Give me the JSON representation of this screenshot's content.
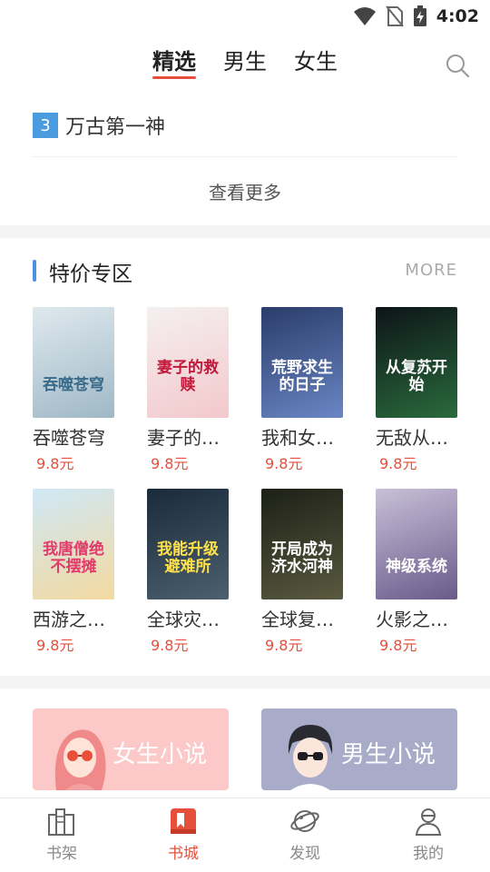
{
  "status_bar": {
    "time": "4:02",
    "icons": [
      "wifi-icon",
      "no-sim-icon",
      "battery-charging-icon"
    ]
  },
  "top_tabs": {
    "tabs": [
      "精选",
      "男生",
      "女生"
    ],
    "active_index": 0,
    "search_icon": "search-icon"
  },
  "rank": {
    "number": "3",
    "title": "万古第一神"
  },
  "more_link": "查看更多",
  "special_section": {
    "title": "特价专区",
    "more": "MORE",
    "books": [
      {
        "title": "吞噬苍穹",
        "price": "9.8元",
        "cover_text": "吞噬苍穹",
        "cover_colors": [
          "#dfe9ee",
          "#9fb8c6"
        ],
        "cover_text_color": "#3a6b8a"
      },
      {
        "title": "妻子的…",
        "price": "9.8元",
        "cover_text": "妻子的救赎",
        "cover_colors": [
          "#f4f0f0",
          "#f3c8cc"
        ],
        "cover_text_color": "#c2183a"
      },
      {
        "title": "我和女…",
        "price": "9.8元",
        "cover_text": "荒野求生的日子",
        "cover_colors": [
          "#2a3c6a",
          "#6a86c4"
        ],
        "cover_text_color": "#ffffff"
      },
      {
        "title": "无敌从…",
        "price": "9.8元",
        "cover_text": "从复苏开始",
        "cover_colors": [
          "#0d1418",
          "#2a6a3c"
        ],
        "cover_text_color": "#ffffff"
      },
      {
        "title": "西游之…",
        "price": "9.8元",
        "cover_text": "我唐僧绝不摆摊",
        "cover_colors": [
          "#cfe8f6",
          "#f3d9a0"
        ],
        "cover_text_color": "#e23a6a"
      },
      {
        "title": "全球灾…",
        "price": "9.8元",
        "cover_text": "我能升级避难所",
        "cover_colors": [
          "#1a2a3a",
          "#4c6070"
        ],
        "cover_text_color": "#ffe14a"
      },
      {
        "title": "全球复…",
        "price": "9.8元",
        "cover_text": "开局成为济水河神",
        "cover_colors": [
          "#1c2016",
          "#5a5a40"
        ],
        "cover_text_color": "#ffffff"
      },
      {
        "title": "火影之…",
        "price": "9.8元",
        "cover_text": "神级系统",
        "cover_colors": [
          "#c8c0d8",
          "#6a5a8a"
        ],
        "cover_text_color": "#ffffff"
      }
    ]
  },
  "categories": [
    {
      "label": "女生小说",
      "color": "#fcc9c8"
    },
    {
      "label": "男生小说",
      "color": "#a8acc8"
    }
  ],
  "bottom_nav": {
    "items": [
      {
        "label": "书架",
        "icon": "bookshelf-icon"
      },
      {
        "label": "书城",
        "icon": "bookstore-icon"
      },
      {
        "label": "发现",
        "icon": "planet-icon"
      },
      {
        "label": "我的",
        "icon": "profile-icon"
      }
    ],
    "active_index": 1
  },
  "colors": {
    "accent": "#e5503a",
    "section_bar": "#4a8fe0",
    "rank_badge": "#4a9be0"
  }
}
